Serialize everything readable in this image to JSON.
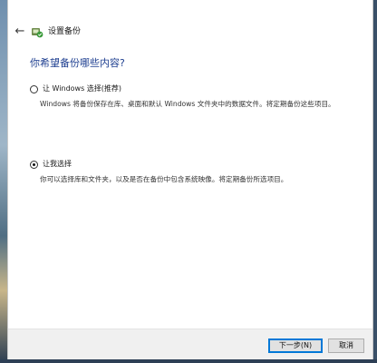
{
  "window": {
    "title": "设置备份",
    "icon": "backup-icon",
    "back_icon": "back-arrow-icon"
  },
  "main": {
    "heading": "你希望备份哪些内容?",
    "options": [
      {
        "label": "让 Windows 选择(推荐)",
        "description": "Windows 将备份保存在库、桌面和默认 Windows 文件夹中的数据文件。将定期备份这些项目。",
        "selected": false
      },
      {
        "label": "让我选择",
        "description": "你可以选择库和文件夹，以及是否在备份中包含系统映像。将定期备份所选项目。",
        "selected": true
      }
    ]
  },
  "footer": {
    "next_label": "下一步(N)",
    "cancel_label": "取消"
  },
  "colors": {
    "heading": "#1e3f90",
    "accent_border": "#0078d7"
  }
}
